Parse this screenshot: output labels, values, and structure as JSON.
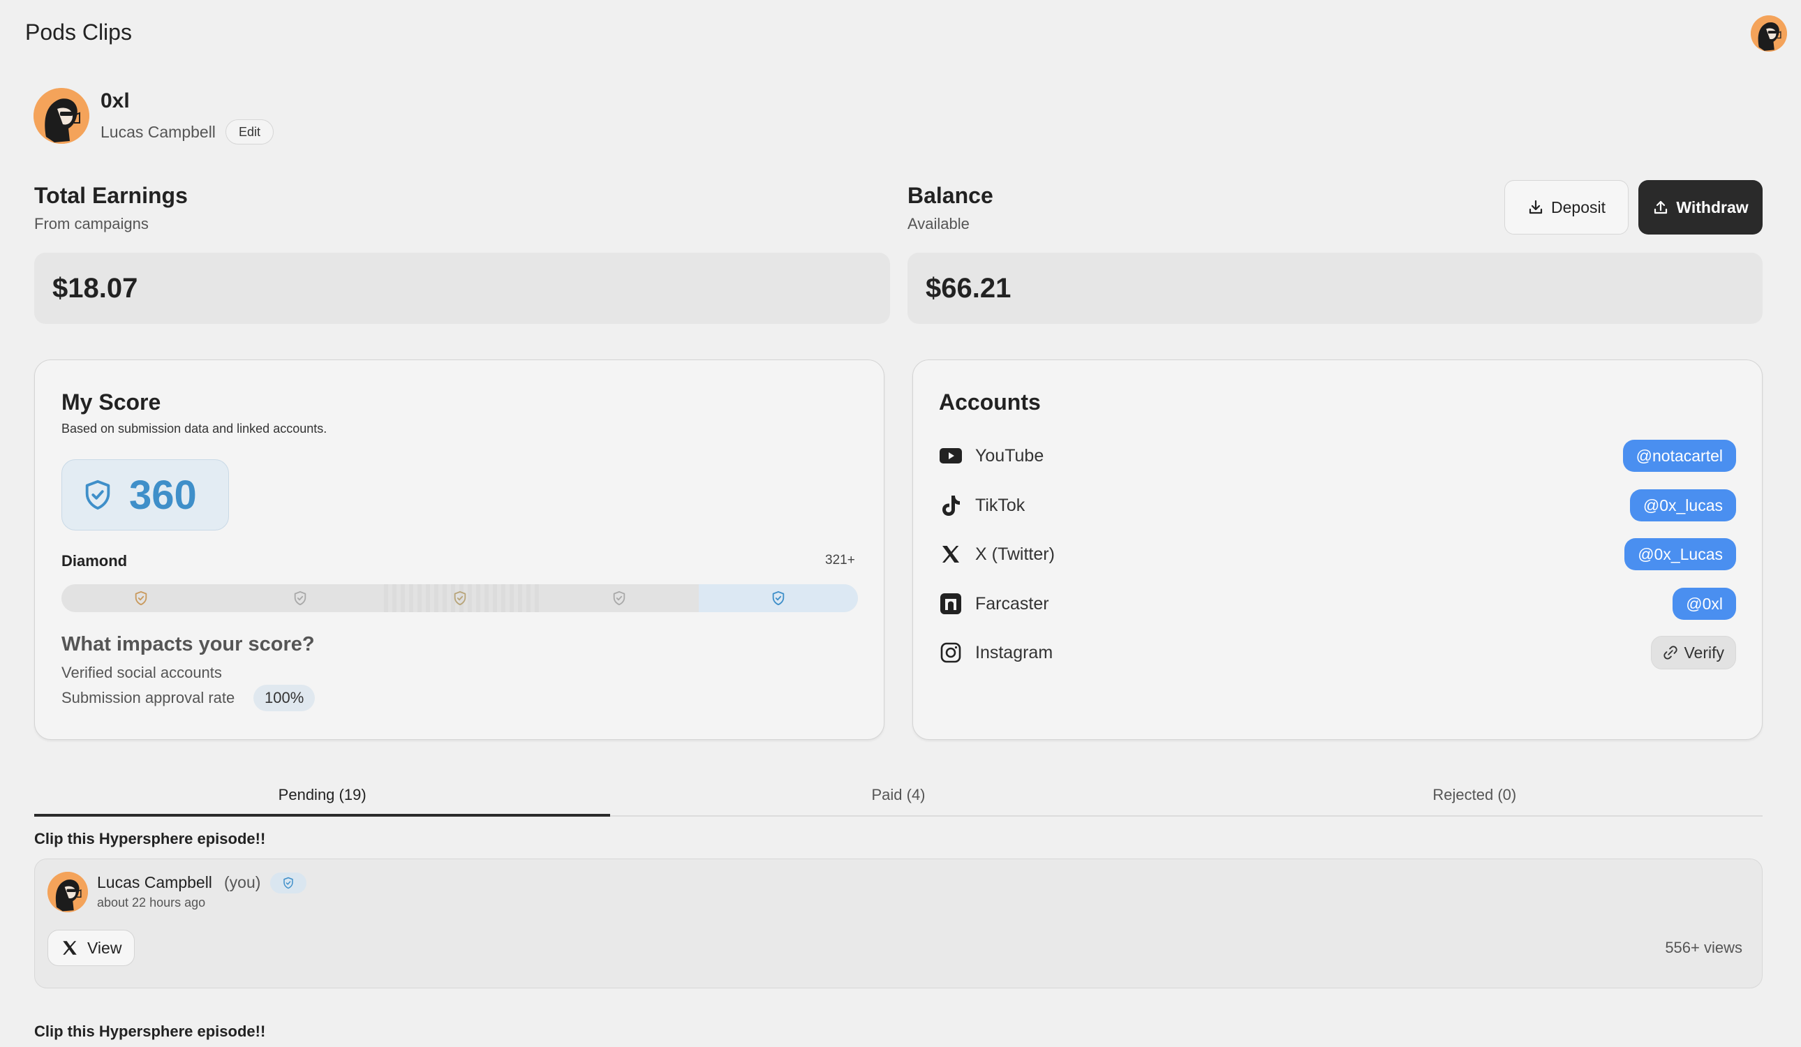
{
  "app": {
    "title": "Pods Clips"
  },
  "profile": {
    "username": "0xl",
    "name": "Lucas Campbell",
    "edit_label": "Edit"
  },
  "earnings": {
    "title": "Total Earnings",
    "subtitle": "From campaigns",
    "amount": "$18.07"
  },
  "balance": {
    "title": "Balance",
    "subtitle": "Available",
    "amount": "$66.21",
    "deposit_label": "Deposit",
    "withdraw_label": "Withdraw"
  },
  "score": {
    "title": "My Score",
    "subtitle": "Based on submission data and linked accounts.",
    "value": "360",
    "tier": "Diamond",
    "tier_threshold": "321+",
    "tiers": [
      {
        "icon": "shield-icon",
        "color": "#c99a5e",
        "active": false
      },
      {
        "icon": "shield-icon",
        "color": "#a9a9a9",
        "active": false
      },
      {
        "icon": "shield-icon",
        "color": "#b8a57a",
        "active": false
      },
      {
        "icon": "shield-icon",
        "color": "#a9a9a9",
        "active": false
      },
      {
        "icon": "shield-icon",
        "color": "#3f8fc9",
        "active": true
      }
    ],
    "impacts_title": "What impacts your score?",
    "impact_1": "Verified social accounts",
    "impact_2": "Submission approval rate",
    "approval_rate": "100%"
  },
  "accounts": {
    "title": "Accounts",
    "items": [
      {
        "platform": "YouTube",
        "icon": "youtube-icon",
        "handle": "@notacartel"
      },
      {
        "platform": "TikTok",
        "icon": "tiktok-icon",
        "handle": "@0x_lucas"
      },
      {
        "platform": "X (Twitter)",
        "icon": "x-icon",
        "handle": "@0x_Lucas"
      },
      {
        "platform": "Farcaster",
        "icon": "farcaster-icon",
        "handle": "@0xl"
      },
      {
        "platform": "Instagram",
        "icon": "instagram-icon",
        "verify_label": "Verify"
      }
    ],
    "accent": "#4a8ff0"
  },
  "tabs": [
    {
      "label": "Pending (19)",
      "active": true
    },
    {
      "label": "Paid (4)",
      "active": false
    },
    {
      "label": "Rejected (0)",
      "active": false
    }
  ],
  "clips": [
    {
      "title": "Clip this Hypersphere episode!!",
      "user": "Lucas Campbell",
      "you_label": "(you)",
      "time": "about 22 hours ago",
      "view_label": "View",
      "views": "556+ views"
    },
    {
      "title": "Clip this Hypersphere episode!!"
    }
  ]
}
